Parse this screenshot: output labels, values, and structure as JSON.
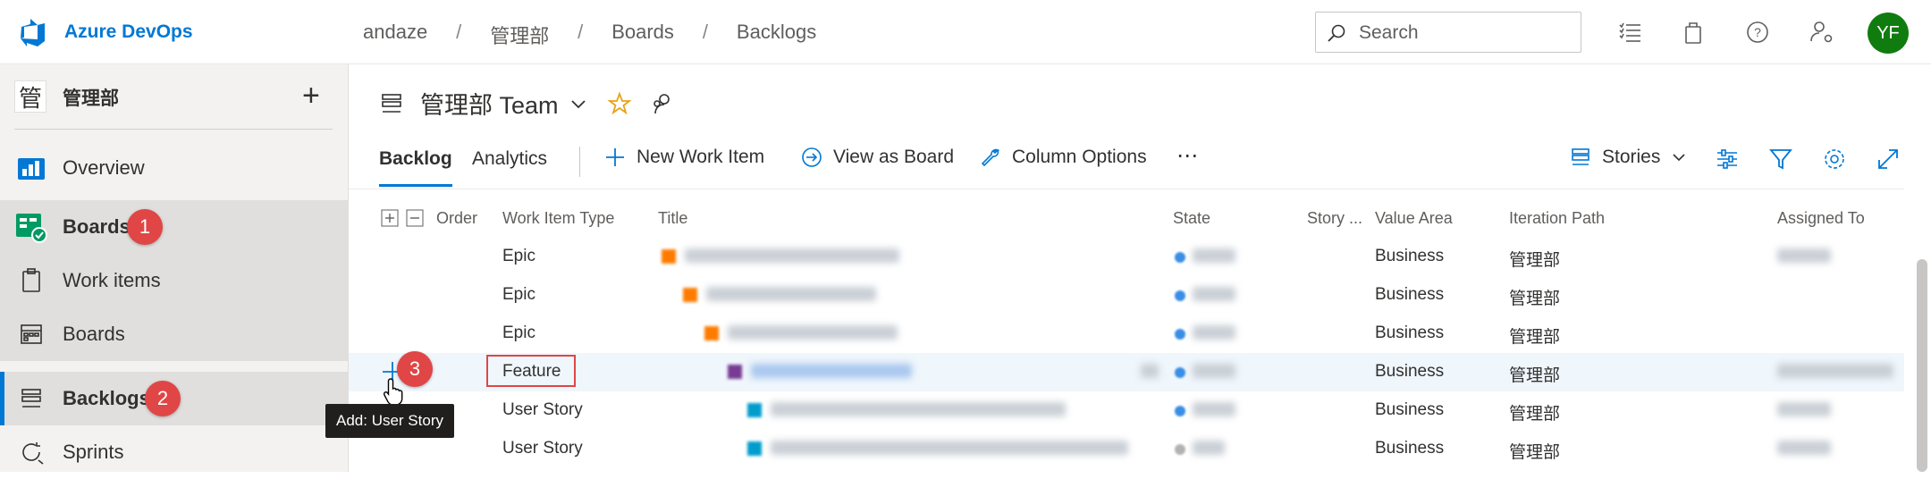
{
  "app": {
    "name": "Azure DevOps",
    "brand_color": "#0078d4"
  },
  "breadcrumb": [
    "andaze",
    "管理部",
    "Boards",
    "Backlogs"
  ],
  "search": {
    "placeholder": "Search"
  },
  "user": {
    "initials": "YF",
    "avatar_color": "#107c10"
  },
  "project": {
    "badge": "管",
    "name": "管理部"
  },
  "sidebar": {
    "items": [
      {
        "label": "Overview",
        "icon": "overview-icon"
      },
      {
        "label": "Boards",
        "icon": "boards-hub-icon",
        "badge": "1"
      },
      {
        "label": "Work items",
        "icon": "work-items-icon"
      },
      {
        "label": "Boards",
        "icon": "kanban-icon"
      },
      {
        "label": "Backlogs",
        "icon": "backlogs-icon",
        "badge": "2"
      },
      {
        "label": "Sprints",
        "icon": "sprints-icon"
      }
    ]
  },
  "team": {
    "title": "管理部 Team"
  },
  "tabs": {
    "backlog": "Backlog",
    "analytics": "Analytics"
  },
  "commands": {
    "new_work_item": "New Work Item",
    "view_as_board": "View as Board",
    "column_options": "Column Options",
    "more": "⋯",
    "level": "Stories"
  },
  "columns": {
    "order": "Order",
    "type": "Work Item Type",
    "title": "Title",
    "state": "State",
    "story_points": "Story ...",
    "value_area": "Value Area",
    "iteration": "Iteration Path",
    "assigned": "Assigned To"
  },
  "rows": [
    {
      "type": "Epic",
      "value_area": "Business",
      "iteration": "管理部"
    },
    {
      "type": "Epic",
      "value_area": "Business",
      "iteration": "管理部"
    },
    {
      "type": "Epic",
      "value_area": "Business",
      "iteration": "管理部"
    },
    {
      "type": "Feature",
      "value_area": "Business",
      "iteration": "管理部"
    },
    {
      "type": "User Story",
      "value_area": "Business",
      "iteration": "管理部"
    },
    {
      "type": "User Story",
      "value_area": "Business",
      "iteration": "管理部"
    }
  ],
  "annotation": {
    "badge3": "3",
    "tooltip": "Add: User Story"
  },
  "colors": {
    "badge": "#e04646",
    "epic": "#ff7b00",
    "feature": "#773b93",
    "story": "#009ccc",
    "active": "#3a8ee6"
  }
}
